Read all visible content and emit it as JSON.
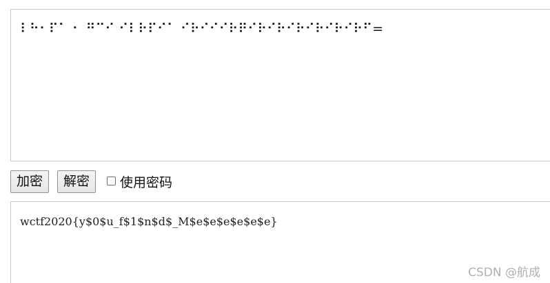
{
  "input": {
    "braille": "⠇⠓⠂⠏⠁ ⠂ ⠛⠉⠊ ⠊⠇⠗⠏⠊⠁ ⠊⠗⠊⠊⠊⠗⠟⠊⠗⠊⠗⠊⠗⠊⠗⠊⠗⠊⠗⠋="
  },
  "controls": {
    "encrypt_label": "加密",
    "decrypt_label": "解密",
    "use_password_label": "使用密码"
  },
  "output": {
    "text": "wctf2020{y$0$u_f$1$n$d$_M$e$e$e$e$e$e}"
  },
  "watermark": "CSDN @航成"
}
